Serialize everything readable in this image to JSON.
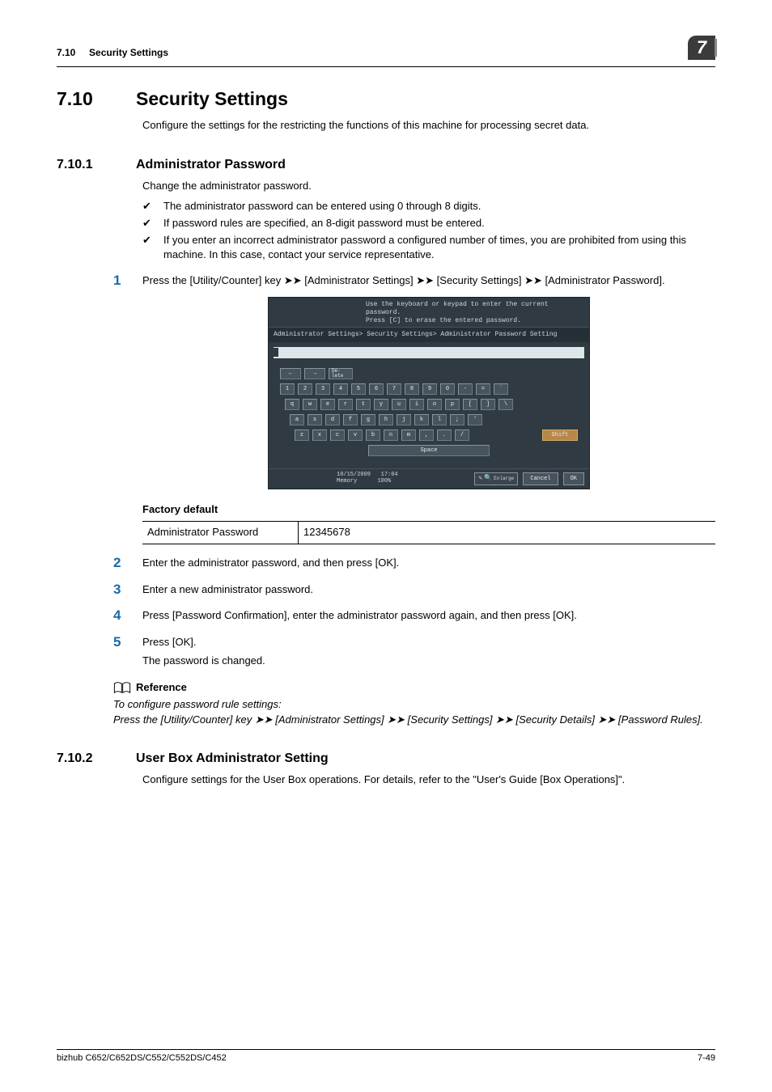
{
  "header": {
    "section_no": "7.10",
    "section_name": "Security Settings",
    "chapter_no": "7"
  },
  "h2": {
    "num": "7.10",
    "title": "Security Settings",
    "intro": "Configure the settings for the restricting the functions of this machine for processing secret data."
  },
  "s1": {
    "num": "7.10.1",
    "title": "Administrator Password",
    "intro": "Change the administrator password.",
    "checks": [
      "The administrator password can be entered using 0 through 8 digits.",
      "If password rules are specified, an 8-digit password must be entered.",
      "If you enter an incorrect administrator password a configured number of times, you are prohibited from using this machine. In this case, contact your service representative."
    ],
    "step1": {
      "n": "1",
      "pre": "Press the [Utility/Counter] key ",
      "p1": " [Administrator Settings] ",
      "p2": " [Security Settings] ",
      "p3": " [Administrator Password]."
    },
    "screenshot": {
      "hint1": "Use the keyboard or keypad to enter the current password.",
      "hint2": "Press [C] to erase the entered password.",
      "breadcrumb": "Administrator Settings> Security Settings> Administrator Password Setting",
      "delete": "De-\nlete",
      "row1": [
        "1",
        "2",
        "3",
        "4",
        "5",
        "6",
        "7",
        "8",
        "9",
        "0",
        "-",
        "=",
        "`"
      ],
      "row2": [
        "q",
        "w",
        "e",
        "r",
        "t",
        "y",
        "u",
        "i",
        "o",
        "p",
        "[",
        "]",
        "\\"
      ],
      "row3": [
        "a",
        "s",
        "d",
        "f",
        "g",
        "h",
        "j",
        "k",
        "l",
        ";",
        "'"
      ],
      "row4": [
        "z",
        "x",
        "c",
        "v",
        "b",
        "n",
        "m",
        ",",
        ".",
        "/"
      ],
      "shift": "Shift",
      "space": "Space",
      "date": "10/15/2009",
      "time": "17:04",
      "mem_label": "Memory",
      "mem_val": "100%",
      "enlarge": "Enlarge",
      "cancel": "Cancel",
      "ok": "OK"
    },
    "factory": {
      "heading": "Factory default",
      "label": "Administrator Password",
      "value": "12345678"
    },
    "step2": {
      "n": "2",
      "text": "Enter the administrator password, and then press [OK]."
    },
    "step3": {
      "n": "3",
      "text": "Enter a new administrator password."
    },
    "step4": {
      "n": "4",
      "text": "Press [Password Confirmation], enter the administrator password again, and then press [OK]."
    },
    "step5": {
      "n": "5",
      "text": "Press [OK].",
      "sub": "The password is changed."
    },
    "reference": {
      "heading": "Reference",
      "line1": "To configure password rule settings:",
      "line2_pre": "Press the [Utility/Counter] key ",
      "line2_p1": " [Administrator Settings] ",
      "line2_p2": " [Security Settings] ",
      "line2_p3": " [Security Details] ",
      "line2_p4": " [Password Rules]."
    }
  },
  "s2": {
    "num": "7.10.2",
    "title": "User Box Administrator Setting",
    "intro": "Configure settings for the User Box operations. For details, refer to the \"User's Guide [Box Operations]\"."
  },
  "footer": {
    "left": "bizhub C652/C652DS/C552/C552DS/C452",
    "right": "7-49"
  },
  "glyph": {
    "rarr": "➤➤"
  }
}
